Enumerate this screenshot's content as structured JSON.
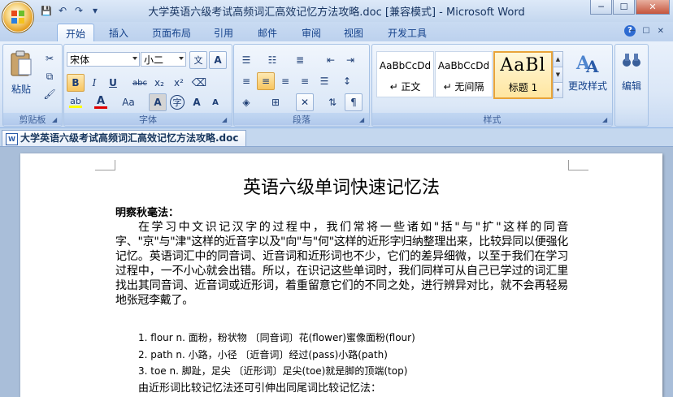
{
  "window": {
    "title": "大学英语六级考试高频词汇高效记忆方法攻略.doc [兼容模式] - Microsoft Word",
    "min": "─",
    "max": "☐",
    "close": "✕"
  },
  "qat": {
    "save": "💾",
    "undo": "↶",
    "redo": "↷",
    "customize": "▾"
  },
  "tabs": [
    "开始",
    "插入",
    "页面布局",
    "引用",
    "邮件",
    "审阅",
    "视图",
    "开发工具"
  ],
  "help": "?",
  "clipboard": {
    "paste_label": "粘贴",
    "group_label": "剪贴板"
  },
  "font": {
    "name": "宋体",
    "size": "小二",
    "group_label": "字体",
    "bold": "B",
    "italic": "I",
    "underline": "U",
    "strike": "abc",
    "subscript": "x₂",
    "superscript": "x²",
    "grow": "A",
    "shrink": "A",
    "change_case": "Aa",
    "char_shade": "A",
    "enclose": "字",
    "phonetic": "文",
    "char_border": "A"
  },
  "paragraph": {
    "group_label": "段落"
  },
  "styles": {
    "group_label": "样式",
    "items": [
      {
        "preview": "AaBbCcDd",
        "name": "↵ 正文"
      },
      {
        "preview": "AaBbCcDd",
        "name": "↵ 无间隔"
      },
      {
        "preview": "AaBl",
        "name": "标题 1"
      }
    ],
    "change_styles": "更改样式"
  },
  "editing": {
    "label": "编辑"
  },
  "doc_tab": "大学英语六级考试高频词汇高效记忆方法攻略.doc",
  "document": {
    "title": "英语六级单词快速记忆法",
    "author": "明察秋毫法：",
    "paragraph": "在学习中文识记汉字的过程中，我们常将一些诸如\"括\"与\"扩\"这样的同音字、\"京\"与\"津\"这样的近音字以及\"向\"与\"何\"这样的近形字归纳整理出来，比较异同以便强化记忆。英语词汇中的同音词、近音词和近形词也不少，它们的差异细微，以至于我们在学习过程中，一不小心就会出错。所以，在识记这些单词时，我们同样可从自己已学过的词汇里找出其同音词、近音词或近形词，着重留意它们的不同之处，进行辨异对比，就不会再轻易地张冠李戴了。",
    "list": [
      "1. flour n. 面粉，粉状物 〔同音词〕花(flower)蜜像面粉(flour)",
      "2. path n. 小路，小径 〔近音词〕经过(pass)小路(path)",
      "3. toe n. 脚趾，足尖 〔近形词〕足尖(toe)就是脚的顶端(top)"
    ],
    "last_line": "由近形词比较记忆法还可引伸出同尾词比较记忆法："
  }
}
